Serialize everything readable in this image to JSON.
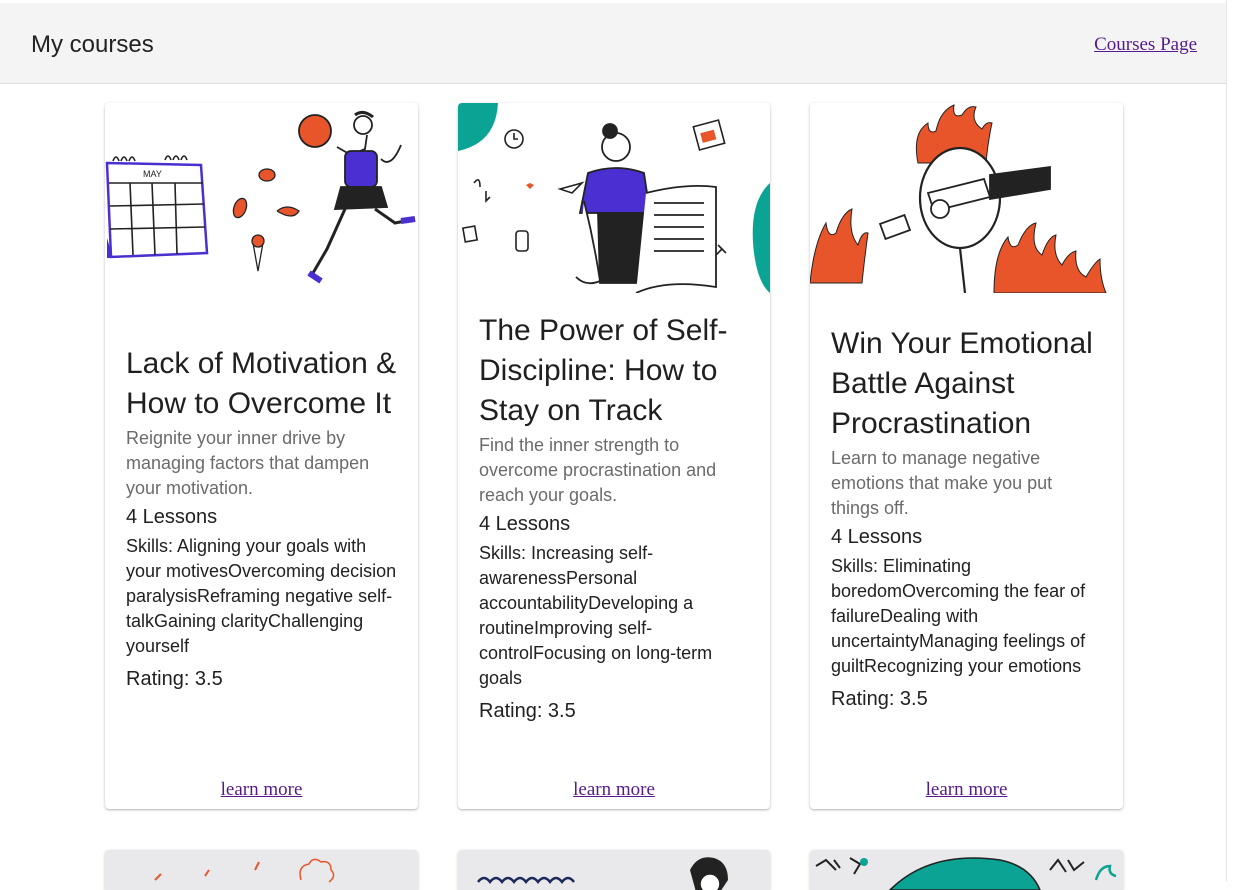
{
  "header": {
    "title": "My courses",
    "courses_link": "Courses Page"
  },
  "colors": {
    "accent_purple": "#4b2fd0",
    "accent_orange": "#e8552a",
    "accent_teal": "#0aa394",
    "link": "#551a8b"
  },
  "courses": [
    {
      "title": "Lack of Motivation & How to Overcome It",
      "description": "Reignite your inner drive by managing factors that dampen your motivation.",
      "lessons": "4 Lessons",
      "skills": "Skills: Aligning your goals with your motivesOvercoming decision paralysisReframing negative self-talkGaining clarityChallenging yourself",
      "rating": "Rating: 3.5",
      "action": "learn more",
      "illustration": {
        "calendar_month": "MAY"
      }
    },
    {
      "title": "The Power of Self-Discipline: How to Stay on Track",
      "description": "Find the inner strength to overcome procrastination and reach your goals.",
      "lessons": "4 Lessons",
      "skills": "Skills: Increasing self-awarenessPersonal accountabilityDeveloping a routineImproving self-controlFocusing on long-term goals",
      "rating": "Rating: 3.5",
      "action": "learn more"
    },
    {
      "title": "Win Your Emotional Battle Against Procrastination",
      "description": "Learn to manage negative emotions that make you put things off.",
      "lessons": "4 Lessons",
      "skills": "Skills: Eliminating boredomOvercoming the fear of failureDealing with uncertaintyManaging feelings of guiltRecognizing your emotions",
      "rating": "Rating: 3.5",
      "action": "learn more"
    }
  ]
}
